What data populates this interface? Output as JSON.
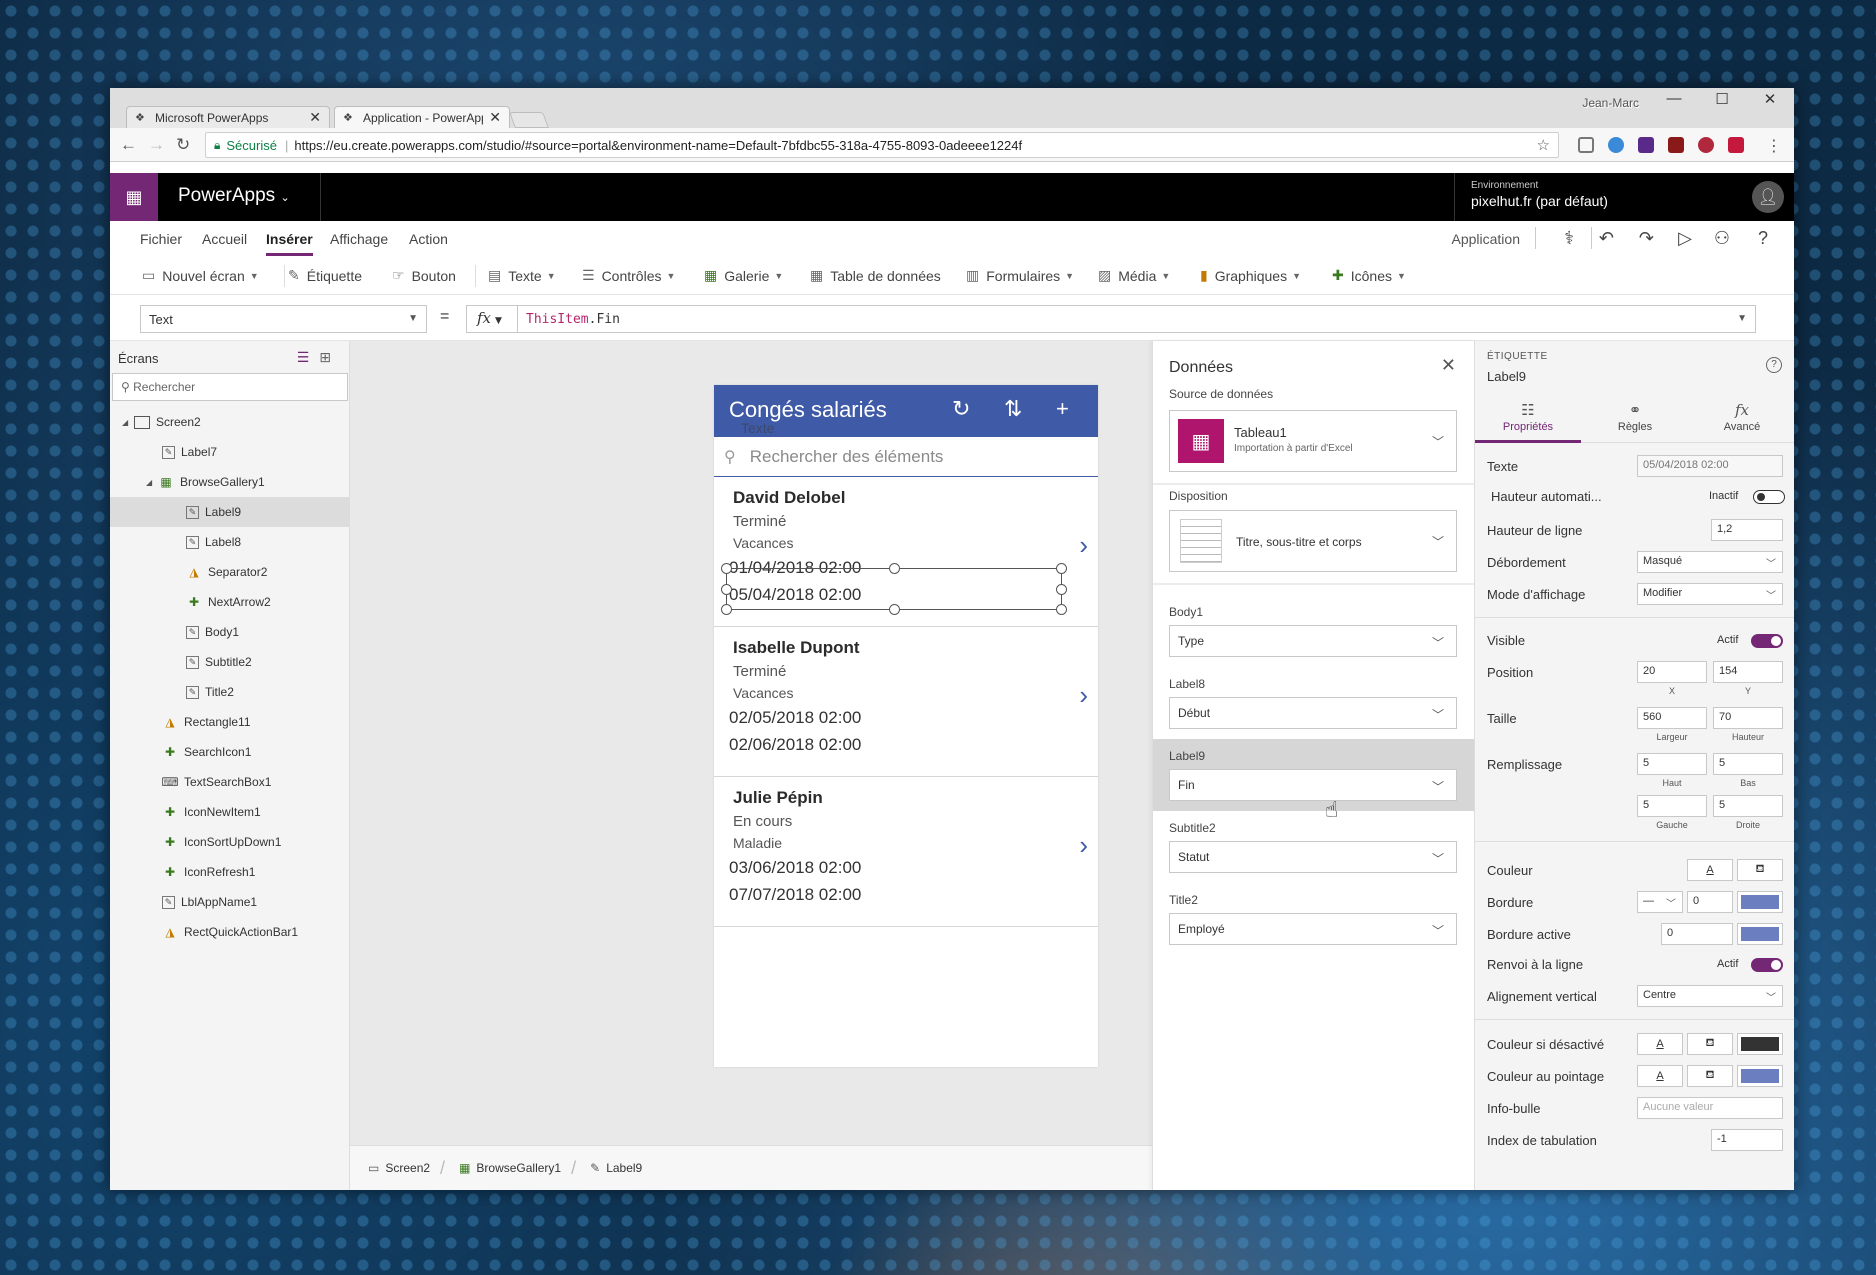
{
  "browser": {
    "tabs": [
      {
        "label": "Microsoft PowerApps",
        "icon": "powerapps-favicon"
      },
      {
        "label": "Application - PowerApps",
        "icon": "powerapps-favicon"
      }
    ],
    "user": "Jean-Marc",
    "secure_label": "Sécurisé",
    "url": "https://eu.create.powerapps.com/studio/#source=portal&environment-name=Default-7bfdbc55-318a-4755-8093-0adeeee1224f"
  },
  "header": {
    "app_name": "PowerApps",
    "env_label": "Environnement",
    "env_value": "pixelhut.fr (par défaut)",
    "brand_color": "#742774"
  },
  "menu": {
    "tabs": [
      "Fichier",
      "Accueil",
      "Insérer",
      "Affichage",
      "Action"
    ],
    "active": "Insérer",
    "app_label": "Application"
  },
  "toolbar": {
    "items": [
      {
        "label": "Nouvel écran",
        "icon": "new-screen-icon"
      },
      {
        "label": "Étiquette",
        "icon": "label-icon"
      },
      {
        "label": "Bouton",
        "icon": "button-icon"
      },
      {
        "label": "Texte",
        "icon": "text-icon"
      },
      {
        "label": "Contrôles",
        "icon": "controls-icon"
      },
      {
        "label": "Galerie",
        "icon": "gallery-icon"
      },
      {
        "label": "Table de données",
        "icon": "data-table-icon"
      },
      {
        "label": "Formulaires",
        "icon": "forms-icon"
      },
      {
        "label": "Média",
        "icon": "media-icon"
      },
      {
        "label": "Graphiques",
        "icon": "charts-icon"
      },
      {
        "label": "Icônes",
        "icon": "icons-icon"
      }
    ]
  },
  "formula": {
    "property": "Text",
    "equals": "=",
    "fx": "fx",
    "keyword": "ThisItem",
    "rest": ".Fin"
  },
  "tree": {
    "title": "Écrans",
    "search_placeholder": "Rechercher",
    "nodes": [
      {
        "label": "Screen2"
      },
      {
        "label": "Label7"
      },
      {
        "label": "BrowseGallery1"
      },
      {
        "label": "Label9"
      },
      {
        "label": "Label8"
      },
      {
        "label": "Separator2"
      },
      {
        "label": "NextArrow2"
      },
      {
        "label": "Body1"
      },
      {
        "label": "Subtitle2"
      },
      {
        "label": "Title2"
      },
      {
        "label": "Rectangle11"
      },
      {
        "label": "SearchIcon1"
      },
      {
        "label": "TextSearchBox1"
      },
      {
        "label": "IconNewItem1"
      },
      {
        "label": "IconSortUpDown1"
      },
      {
        "label": "IconRefresh1"
      },
      {
        "label": "LblAppName1"
      },
      {
        "label": "RectQuickActionBar1"
      }
    ]
  },
  "app": {
    "title": "Congés salariés",
    "ghost_label": "Texte",
    "search_placeholder": "Rechercher des éléments",
    "header_color": "#3f5aa6",
    "items": [
      {
        "title": "David Delobel",
        "subtitle": "Terminé",
        "body": "Vacances",
        "start": "01/04/2018 02:00",
        "end": "05/04/2018 02:00"
      },
      {
        "title": "Isabelle Dupont",
        "subtitle": "Terminé",
        "body": "Vacances",
        "start": "02/05/2018 02:00",
        "end": "02/06/2018 02:00"
      },
      {
        "title": "Julie Pépin",
        "subtitle": "En cours",
        "body": "Maladie",
        "start": "03/06/2018 02:00",
        "end": "07/07/2018 02:00"
      }
    ]
  },
  "breadcrumbs": [
    "Screen2",
    "BrowseGallery1",
    "Label9"
  ],
  "data_panel": {
    "title": "Données",
    "source_label": "Source de données",
    "source_name": "Tableau1",
    "source_sub": "Importation à partir d'Excel",
    "layout_label": "Disposition",
    "layout_value": "Titre, sous-titre et corps",
    "fields": [
      {
        "name": "Body1",
        "value": "Type"
      },
      {
        "name": "Label8",
        "value": "Début"
      },
      {
        "name": "Label9",
        "value": "Fin"
      },
      {
        "name": "Subtitle2",
        "value": "Statut"
      },
      {
        "name": "Title2",
        "value": "Employé"
      }
    ]
  },
  "props": {
    "kind": "ÉTIQUETTE",
    "name": "Label9",
    "tabs": [
      "Propriétés",
      "Règles",
      "Avancé"
    ],
    "texte_label": "Texte",
    "texte_value": "05/04/2018 02:00",
    "autoheight_label": "Hauteur automati...",
    "autoheight_state": "Inactif",
    "lineheight_label": "Hauteur de ligne",
    "lineheight_value": "1,2",
    "overflow_label": "Débordement",
    "overflow_value": "Masqué",
    "displaymode_label": "Mode d'affichage",
    "displaymode_value": "Modifier",
    "visible_label": "Visible",
    "visible_state": "Actif",
    "position_label": "Position",
    "pos_x": "20",
    "pos_y": "154",
    "cap_x": "X",
    "cap_y": "Y",
    "size_label": "Taille",
    "width": "560",
    "height": "70",
    "cap_w": "Largeur",
    "cap_h": "Hauteur",
    "padding_label": "Remplissage",
    "pad_top": "5",
    "pad_bottom": "5",
    "pad_left": "5",
    "pad_right": "5",
    "cap_top": "Haut",
    "cap_bottom": "Bas",
    "cap_left": "Gauche",
    "cap_right": "Droite",
    "color_label": "Couleur",
    "border_label": "Bordure",
    "border_value": "0",
    "activeborder_label": "Bordure active",
    "activeborder_value": "0",
    "wrap_label": "Renvoi à la ligne",
    "wrap_state": "Actif",
    "valign_label": "Alignement vertical",
    "valign_value": "Centre",
    "disabledcolor_label": "Couleur si désactivé",
    "hovercolor_label": "Couleur au pointage",
    "tooltip_label": "Info-bulle",
    "tooltip_placeholder": "Aucune valeur",
    "tabindex_label": "Index de tabulation",
    "tabindex_value": "-1",
    "swatch_blue": "#6b7fc0",
    "swatch_dark": "#333333"
  }
}
